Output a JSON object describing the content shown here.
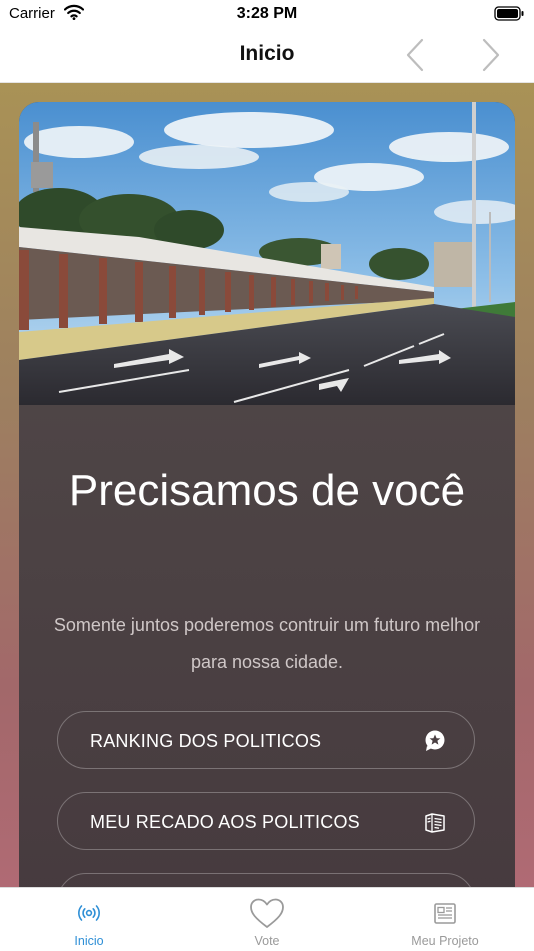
{
  "status_bar": {
    "carrier": "Carrier",
    "time": "3:28 PM",
    "icons": [
      "wifi-icon",
      "battery-icon"
    ]
  },
  "nav": {
    "title": "Inicio",
    "back_icon": "chevron-left-icon",
    "forward_icon": "chevron-right-icon"
  },
  "hero": {
    "title": "Precisamos de você",
    "subtitle": "Somente juntos poderemos contruir um futuro melhor para nossa cidade."
  },
  "menu": [
    {
      "label": "RANKING DOS POLITICOS",
      "icon": "star-chat-icon"
    },
    {
      "label": "MEU RECADO AOS POLITICOS",
      "icon": "newspaper-icon"
    }
  ],
  "tabs": [
    {
      "label": "Inicio",
      "icon": "broadcast-icon",
      "active": true
    },
    {
      "label": "Vote",
      "icon": "heart-icon",
      "active": false
    },
    {
      "label": "Meu Projeto",
      "icon": "newspaper-icon",
      "active": false
    }
  ],
  "colors": {
    "accent": "#2e8fd6",
    "inactive": "#9a9a9a",
    "card": "#4a3f42",
    "background_top": "#a99256",
    "background_bottom": "#b06a74"
  }
}
